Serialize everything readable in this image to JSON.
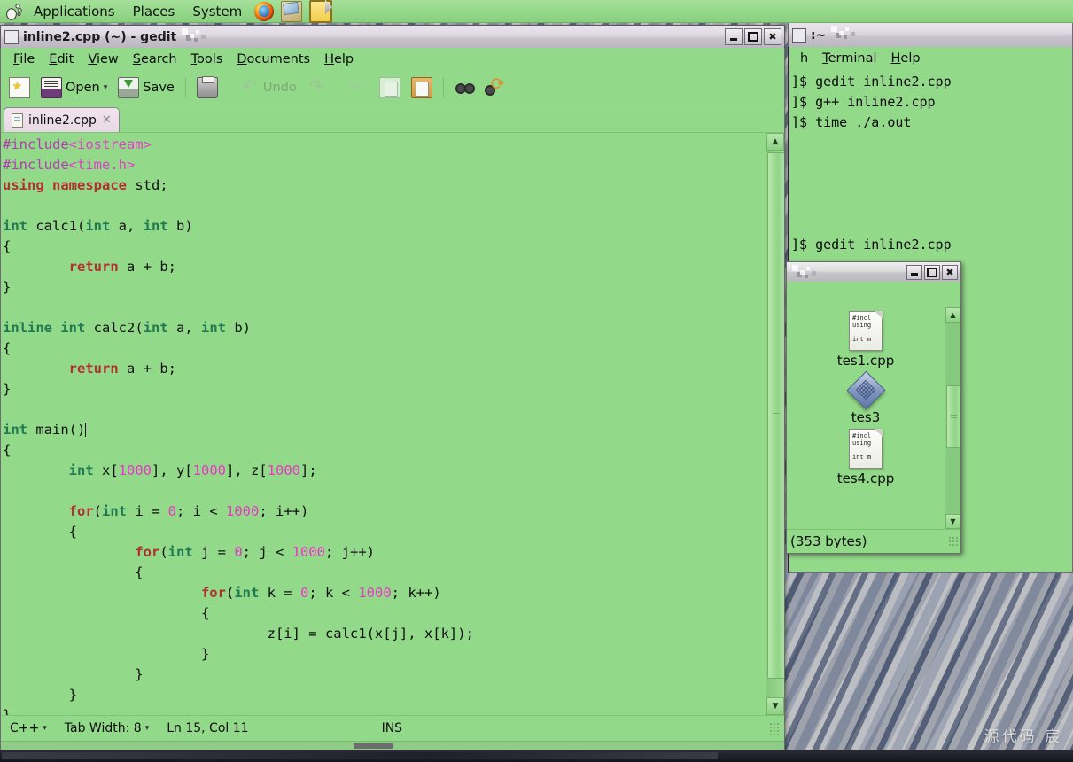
{
  "panel": {
    "menus": [
      "Applications",
      "Places",
      "System"
    ],
    "launchers": [
      "firefox-icon",
      "evolution-mail-icon",
      "text-editor-icon"
    ]
  },
  "gedit": {
    "title": "inline2.cpp (~) - gedit",
    "window_buttons": [
      "minimize",
      "maximize",
      "close"
    ],
    "menubar": [
      "File",
      "Edit",
      "View",
      "Search",
      "Tools",
      "Documents",
      "Help"
    ],
    "toolbar": {
      "new_label": "",
      "open_label": "Open",
      "save_label": "Save",
      "undo_label": "Undo",
      "print_label": "",
      "items": [
        "new-document",
        "open",
        "save",
        "print",
        "undo",
        "redo",
        "cut",
        "copy",
        "paste",
        "find",
        "find-replace"
      ]
    },
    "tab": {
      "label": "inline2.cpp",
      "close": "✕"
    },
    "code_lines": [
      [
        {
          "t": "#include",
          "c": "k-pre"
        },
        {
          "t": "<iostream>",
          "c": "k-str"
        }
      ],
      [
        {
          "t": "#include",
          "c": "k-pre"
        },
        {
          "t": "<time.h>",
          "c": "k-str"
        }
      ],
      [
        {
          "t": "using namespace",
          "c": "k-kw"
        },
        {
          "t": " std;",
          "c": ""
        }
      ],
      [],
      [
        {
          "t": "int",
          "c": "k-type"
        },
        {
          "t": " calc1(",
          "c": ""
        },
        {
          "t": "int",
          "c": "k-type"
        },
        {
          "t": " a, ",
          "c": ""
        },
        {
          "t": "int",
          "c": "k-type"
        },
        {
          "t": " b)",
          "c": ""
        }
      ],
      [
        {
          "t": "{",
          "c": ""
        }
      ],
      [
        {
          "t": "        ",
          "c": ""
        },
        {
          "t": "return",
          "c": "k-kw"
        },
        {
          "t": " a + b;",
          "c": ""
        }
      ],
      [
        {
          "t": "}",
          "c": ""
        }
      ],
      [],
      [
        {
          "t": "inline int",
          "c": "k-type"
        },
        {
          "t": " calc2(",
          "c": ""
        },
        {
          "t": "int",
          "c": "k-type"
        },
        {
          "t": " a, ",
          "c": ""
        },
        {
          "t": "int",
          "c": "k-type"
        },
        {
          "t": " b)",
          "c": ""
        }
      ],
      [
        {
          "t": "{",
          "c": ""
        }
      ],
      [
        {
          "t": "        ",
          "c": ""
        },
        {
          "t": "return",
          "c": "k-kw"
        },
        {
          "t": " a + b;",
          "c": ""
        }
      ],
      [
        {
          "t": "}",
          "c": ""
        }
      ],
      [],
      [
        {
          "t": "int",
          "c": "k-type"
        },
        {
          "t": " main()",
          "c": ""
        },
        {
          "t": "|",
          "c": "caret-mark"
        }
      ],
      [
        {
          "t": "{",
          "c": ""
        }
      ],
      [
        {
          "t": "        ",
          "c": ""
        },
        {
          "t": "int",
          "c": "k-type"
        },
        {
          "t": " x[",
          "c": ""
        },
        {
          "t": "1000",
          "c": "k-num"
        },
        {
          "t": "], y[",
          "c": ""
        },
        {
          "t": "1000",
          "c": "k-num"
        },
        {
          "t": "], z[",
          "c": ""
        },
        {
          "t": "1000",
          "c": "k-num"
        },
        {
          "t": "];",
          "c": ""
        }
      ],
      [],
      [
        {
          "t": "        ",
          "c": ""
        },
        {
          "t": "for",
          "c": "k-kw"
        },
        {
          "t": "(",
          "c": ""
        },
        {
          "t": "int",
          "c": "k-type"
        },
        {
          "t": " i = ",
          "c": ""
        },
        {
          "t": "0",
          "c": "k-num"
        },
        {
          "t": "; i < ",
          "c": ""
        },
        {
          "t": "1000",
          "c": "k-num"
        },
        {
          "t": "; i++)",
          "c": ""
        }
      ],
      [
        {
          "t": "        {",
          "c": ""
        }
      ],
      [
        {
          "t": "                ",
          "c": ""
        },
        {
          "t": "for",
          "c": "k-kw"
        },
        {
          "t": "(",
          "c": ""
        },
        {
          "t": "int",
          "c": "k-type"
        },
        {
          "t": " j = ",
          "c": ""
        },
        {
          "t": "0",
          "c": "k-num"
        },
        {
          "t": "; j < ",
          "c": ""
        },
        {
          "t": "1000",
          "c": "k-num"
        },
        {
          "t": "; j++)",
          "c": ""
        }
      ],
      [
        {
          "t": "                {",
          "c": ""
        }
      ],
      [
        {
          "t": "                        ",
          "c": ""
        },
        {
          "t": "for",
          "c": "k-kw"
        },
        {
          "t": "(",
          "c": ""
        },
        {
          "t": "int",
          "c": "k-type"
        },
        {
          "t": " k = ",
          "c": ""
        },
        {
          "t": "0",
          "c": "k-num"
        },
        {
          "t": "; k < ",
          "c": ""
        },
        {
          "t": "1000",
          "c": "k-num"
        },
        {
          "t": "; k++)",
          "c": ""
        }
      ],
      [
        {
          "t": "                        {",
          "c": ""
        }
      ],
      [
        {
          "t": "                                z[i] = calc1(x[j], x[k]);",
          "c": ""
        }
      ],
      [
        {
          "t": "                        }",
          "c": ""
        }
      ],
      [
        {
          "t": "                }",
          "c": ""
        }
      ],
      [
        {
          "t": "        }",
          "c": ""
        }
      ],
      [
        {
          "t": "}",
          "c": ""
        }
      ]
    ],
    "statusbar": {
      "language": "C++",
      "tab_width": "Tab Width: 8",
      "position": "Ln 15, Col 11",
      "mode": "INS"
    }
  },
  "terminal": {
    "title": ":~",
    "menubar": [
      "h",
      "Terminal",
      "Help"
    ],
    "lines": [
      "]$ gedit inline2.cpp",
      "]$ g++ inline2.cpp",
      "]$ time ./a.out",
      "",
      "",
      "",
      "",
      "",
      "]$ gedit inline2.cpp"
    ]
  },
  "file_manager": {
    "window_buttons": [
      "minimize",
      "maximize",
      "close"
    ],
    "items": [
      {
        "name": "tes1.cpp",
        "icon": "cpp-source-icon",
        "preview": [
          "#incl",
          "using",
          "",
          "int m"
        ]
      },
      {
        "name": "tes3",
        "icon": "binary-executable-icon",
        "preview": []
      },
      {
        "name": "tes4.cpp",
        "icon": "cpp-source-icon",
        "preview": [
          "#incl",
          "using",
          "",
          "int m"
        ]
      }
    ],
    "status": "(353 bytes)"
  },
  "watermark": "源代码  宸"
}
